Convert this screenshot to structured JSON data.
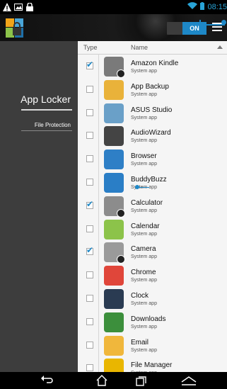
{
  "status": {
    "time": "08:15"
  },
  "actionbar": {
    "toggle_label": "ON"
  },
  "sidebar": {
    "title": "App Locker",
    "item": "File Protection"
  },
  "list": {
    "col_type": "Type",
    "col_name": "Name",
    "apps": [
      {
        "name": "Amazon Kindle",
        "sub": "System app",
        "checked": true,
        "locked": true,
        "color": "#7a7a7a"
      },
      {
        "name": "App Backup",
        "sub": "System app",
        "checked": false,
        "locked": false,
        "color": "#e9b23a"
      },
      {
        "name": "ASUS Studio",
        "sub": "System app",
        "checked": false,
        "locked": false,
        "color": "#6aa0c8"
      },
      {
        "name": "AudioWizard",
        "sub": "System app",
        "checked": false,
        "locked": false,
        "color": "#444444"
      },
      {
        "name": "Browser",
        "sub": "System app",
        "checked": false,
        "locked": false,
        "color": "#2e7fc6"
      },
      {
        "name": "BuddyBuzz",
        "sub": "System app",
        "checked": false,
        "locked": false,
        "color": "#2a7ec6"
      },
      {
        "name": "Calculator",
        "sub": "System app",
        "checked": true,
        "locked": true,
        "color": "#8c8c8c"
      },
      {
        "name": "Calendar",
        "sub": "System app",
        "checked": false,
        "locked": false,
        "color": "#8cc34a"
      },
      {
        "name": "Camera",
        "sub": "System app",
        "checked": true,
        "locked": true,
        "color": "#9a9a9a"
      },
      {
        "name": "Chrome",
        "sub": "System app",
        "checked": false,
        "locked": false,
        "color": "#e0463a"
      },
      {
        "name": "Clock",
        "sub": "System app",
        "checked": false,
        "locked": false,
        "color": "#2a3b52"
      },
      {
        "name": "Downloads",
        "sub": "System app",
        "checked": false,
        "locked": false,
        "color": "#3c8f3c"
      },
      {
        "name": "Email",
        "sub": "System app",
        "checked": false,
        "locked": false,
        "color": "#f0b73c"
      },
      {
        "name": "File Manager",
        "sub": "System app",
        "checked": false,
        "locked": false,
        "color": "#e9b600"
      }
    ]
  }
}
